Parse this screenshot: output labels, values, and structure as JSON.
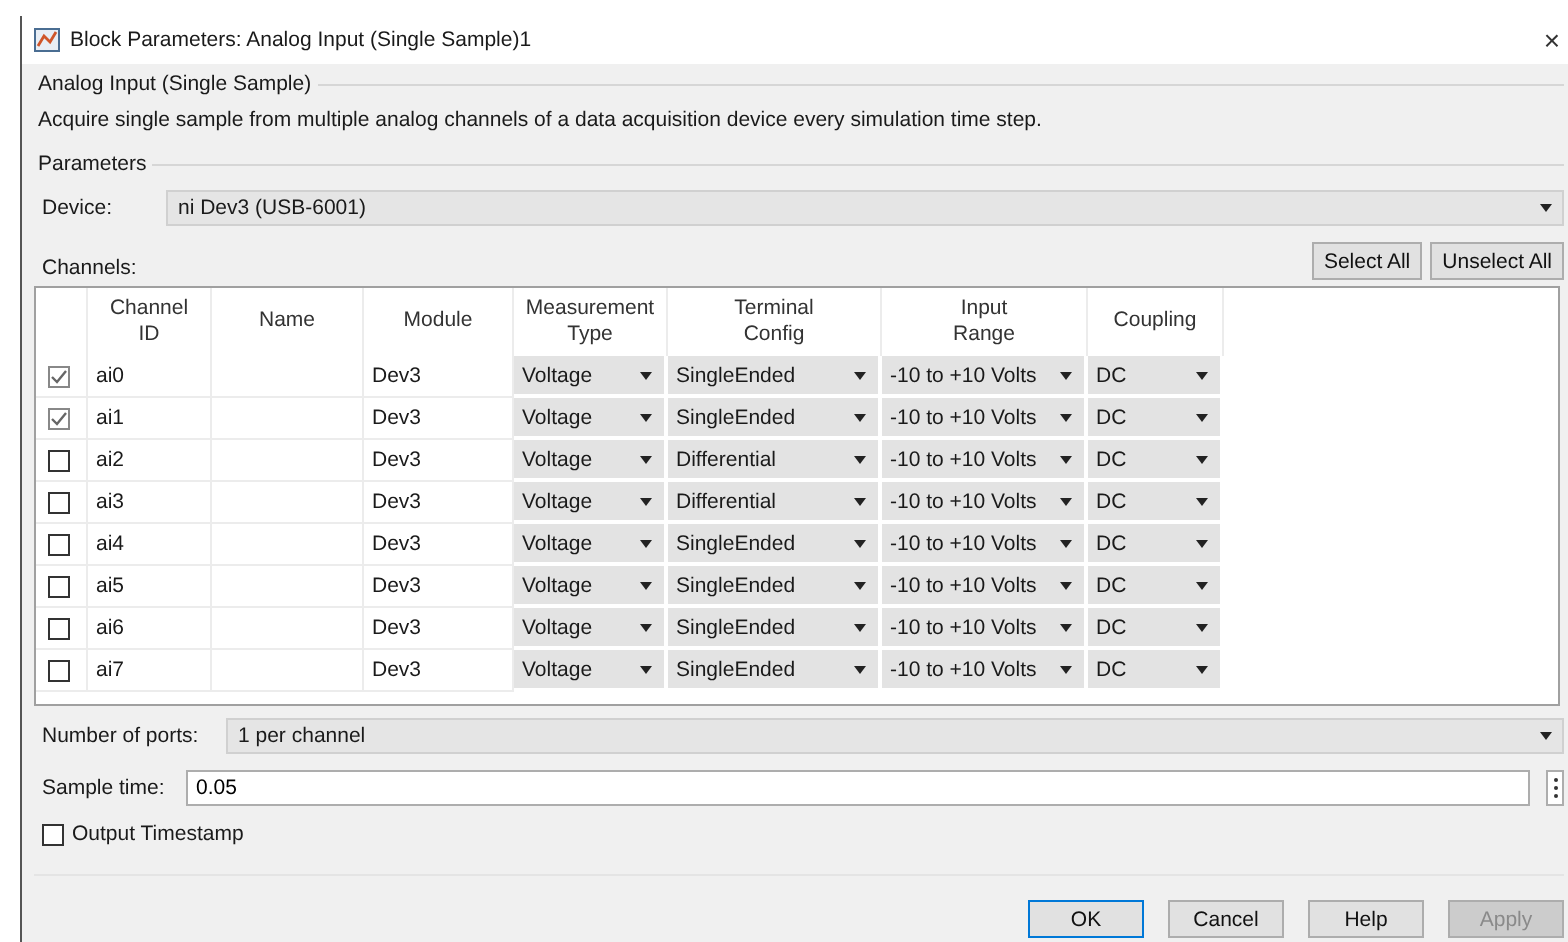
{
  "window": {
    "title": "Block Parameters: Analog Input (Single Sample)1",
    "close": "×"
  },
  "block": {
    "title": "Analog Input (Single Sample)",
    "description": "Acquire single sample from multiple analog channels of a data acquisition device every simulation time step."
  },
  "parameters": {
    "title": "Parameters",
    "device": {
      "label": "Device:",
      "value": "ni Dev3 (USB-6001)"
    },
    "channels_label": "Channels:",
    "channel_buttons": [
      {
        "label": "Select All"
      },
      {
        "label": "Unselect All"
      }
    ],
    "table": {
      "columns": [
        {
          "lines": [
            "Channel",
            "ID"
          ]
        },
        {
          "lines": [
            "Name"
          ]
        },
        {
          "lines": [
            "Module"
          ]
        },
        {
          "lines": [
            "Measurement",
            "Type"
          ]
        },
        {
          "lines": [
            "Terminal",
            "Config"
          ]
        },
        {
          "lines": [
            "Input",
            "Range"
          ]
        },
        {
          "lines": [
            "Coupling"
          ]
        }
      ],
      "rows": [
        {
          "checked": true,
          "id": "ai0",
          "module": "Dev3",
          "measurement": "Voltage",
          "terminal": "SingleEnded",
          "range": "-10 to +10 Volts",
          "coupling": "DC"
        },
        {
          "checked": true,
          "id": "ai1",
          "module": "Dev3",
          "measurement": "Voltage",
          "terminal": "SingleEnded",
          "range": "-10 to +10 Volts",
          "coupling": "DC"
        },
        {
          "checked": false,
          "id": "ai2",
          "module": "Dev3",
          "measurement": "Voltage",
          "terminal": "Differential",
          "range": "-10 to +10 Volts",
          "coupling": "DC"
        },
        {
          "checked": false,
          "id": "ai3",
          "module": "Dev3",
          "measurement": "Voltage",
          "terminal": "Differential",
          "range": "-10 to +10 Volts",
          "coupling": "DC"
        },
        {
          "checked": false,
          "id": "ai4",
          "module": "Dev3",
          "measurement": "Voltage",
          "terminal": "SingleEnded",
          "range": "-10 to +10 Volts",
          "coupling": "DC"
        },
        {
          "checked": false,
          "id": "ai5",
          "module": "Dev3",
          "measurement": "Voltage",
          "terminal": "SingleEnded",
          "range": "-10 to +10 Volts",
          "coupling": "DC"
        },
        {
          "checked": false,
          "id": "ai6",
          "module": "Dev3",
          "measurement": "Voltage",
          "terminal": "SingleEnded",
          "range": "-10 to +10 Volts",
          "coupling": "DC"
        },
        {
          "checked": false,
          "id": "ai7",
          "module": "Dev3",
          "measurement": "Voltage",
          "terminal": "SingleEnded",
          "range": "-10 to +10 Volts",
          "coupling": "DC"
        }
      ]
    },
    "ports": {
      "label": "Number of ports:",
      "value": "1 per channel"
    },
    "sample_time": {
      "label": "Sample time:",
      "value": "0.05"
    },
    "output_timestamp": {
      "label": "Output Timestamp",
      "checked": false
    }
  },
  "buttons": [
    {
      "label": "OK",
      "focused": true,
      "disabled": false
    },
    {
      "label": "Cancel",
      "focused": false,
      "disabled": false
    },
    {
      "label": "Help",
      "focused": false,
      "disabled": false
    },
    {
      "label": "Apply",
      "focused": false,
      "disabled": true
    }
  ]
}
